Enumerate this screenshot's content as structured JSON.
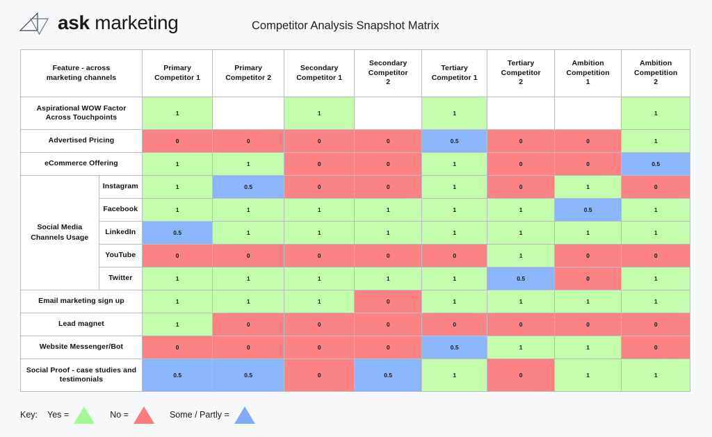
{
  "brand": {
    "bold_word": "ask",
    "light_word": " marketing",
    "logo_icon": "two-overlapping-triangles-icon"
  },
  "document": {
    "title": "Competitor Analysis Snapshot Matrix"
  },
  "table": {
    "columns": [
      "Feature - across marketing channels",
      "Primary Competitor 1",
      "Primary Competitor 2",
      "Secondary Competitor 1",
      "Secondary Competitor 2",
      "Tertiary Competitor 1",
      "Tertiary Competitor 2",
      "Ambition Competition 1",
      "Ambition Competition 2"
    ],
    "columns_display": [
      "Feature - across\nmarketing channels",
      "Primary\nCompetitor 1",
      "Primary\nCompetitor 2",
      "Secondary\nCompetitor 1",
      "Secondary\nCompetitor\n2",
      "Tertiary\nCompetitor 1",
      "Tertiary\nCompetitor\n2",
      "Ambition\nCompetition\n1",
      "Ambition\nCompetition\n2"
    ],
    "group_label": "Social Media Channels Usage",
    "rows": [
      {
        "label": "Aspirational WOW Factor Across Touchpoints",
        "values": [
          "1",
          "",
          "1",
          "",
          "1",
          "",
          "",
          "1"
        ],
        "colors": [
          "green",
          "empty",
          "green",
          "empty",
          "green",
          "empty",
          "empty",
          "green"
        ]
      },
      {
        "label": "Advertised Pricing",
        "values": [
          "0",
          "0",
          "0",
          "0",
          "0.5",
          "0",
          "0",
          "1"
        ],
        "colors": [
          "red",
          "red",
          "red",
          "red",
          "blue",
          "red",
          "red",
          "green"
        ]
      },
      {
        "label": "eCommerce Offering",
        "values": [
          "1",
          "1",
          "0",
          "0",
          "1",
          "0",
          "0",
          "0.5"
        ],
        "colors": [
          "green",
          "green",
          "red",
          "red",
          "green",
          "red",
          "red",
          "blue"
        ]
      },
      {
        "label": "Instagram",
        "group": "Social Media Channels Usage",
        "values": [
          "1",
          "0.5",
          "0",
          "0",
          "1",
          "0",
          "1",
          "0"
        ],
        "colors": [
          "green",
          "blue",
          "red",
          "red",
          "green",
          "red",
          "green",
          "red"
        ]
      },
      {
        "label": "Facebook",
        "group": "Social Media Channels Usage",
        "values": [
          "1",
          "1",
          "1",
          "1",
          "1",
          "1",
          "0.5",
          "1"
        ],
        "colors": [
          "green",
          "green",
          "green",
          "green",
          "green",
          "green",
          "blue",
          "green"
        ]
      },
      {
        "label": "LinkedIn",
        "group": "Social Media Channels Usage",
        "values": [
          "0.5",
          "1",
          "1",
          "1",
          "1",
          "1",
          "1",
          "1"
        ],
        "colors": [
          "blue",
          "green",
          "green",
          "green",
          "green",
          "green",
          "green",
          "green"
        ]
      },
      {
        "label": "YouTube",
        "group": "Social Media Channels Usage",
        "values": [
          "0",
          "0",
          "0",
          "0",
          "0",
          "1",
          "0",
          "0"
        ],
        "colors": [
          "red",
          "red",
          "red",
          "red",
          "red",
          "green",
          "red",
          "red"
        ]
      },
      {
        "label": "Twitter",
        "group": "Social Media Channels Usage",
        "values": [
          "1",
          "1",
          "1",
          "1",
          "1",
          "0.5",
          "0",
          "1"
        ],
        "colors": [
          "green",
          "green",
          "green",
          "green",
          "green",
          "blue",
          "red",
          "green"
        ]
      },
      {
        "label": "Email marketing sign up",
        "values": [
          "1",
          "1",
          "1",
          "0",
          "1",
          "1",
          "1",
          "1"
        ],
        "colors": [
          "green",
          "green",
          "green",
          "red",
          "green",
          "green",
          "green",
          "green"
        ]
      },
      {
        "label": "Lead magnet",
        "values": [
          "1",
          "0",
          "0",
          "0",
          "0",
          "0",
          "0",
          "0"
        ],
        "colors": [
          "green",
          "red",
          "red",
          "red",
          "red",
          "red",
          "red",
          "red"
        ]
      },
      {
        "label": "Website Messenger/Bot",
        "values": [
          "0",
          "0",
          "0",
          "0",
          "0.5",
          "1",
          "1",
          "0"
        ],
        "colors": [
          "red",
          "red",
          "red",
          "red",
          "blue",
          "green",
          "green",
          "red"
        ]
      },
      {
        "label": "Social Proof - case studies and testimonials",
        "values": [
          "0.5",
          "0.5",
          "0",
          "0.5",
          "1",
          "0",
          "1",
          "1"
        ],
        "colors": [
          "blue",
          "blue",
          "red",
          "blue",
          "green",
          "red",
          "green",
          "green"
        ]
      }
    ]
  },
  "key": {
    "word": "Key:",
    "items": [
      {
        "label": "Yes =",
        "swatch": "green-triangle-icon",
        "color": "#a8f795"
      },
      {
        "label": "No =",
        "swatch": "red-triangle-icon",
        "color": "#fb7a7a"
      },
      {
        "label": "Some / Partly =",
        "swatch": "blue-triangle-icon",
        "color": "#7fabf7"
      }
    ]
  },
  "colors": {
    "green": "#c2fcac",
    "red": "#fb8383",
    "blue": "#8cb6fb",
    "empty": "#ffffff",
    "page_background": "#f7f8fa",
    "border": "#b9bcc0"
  }
}
